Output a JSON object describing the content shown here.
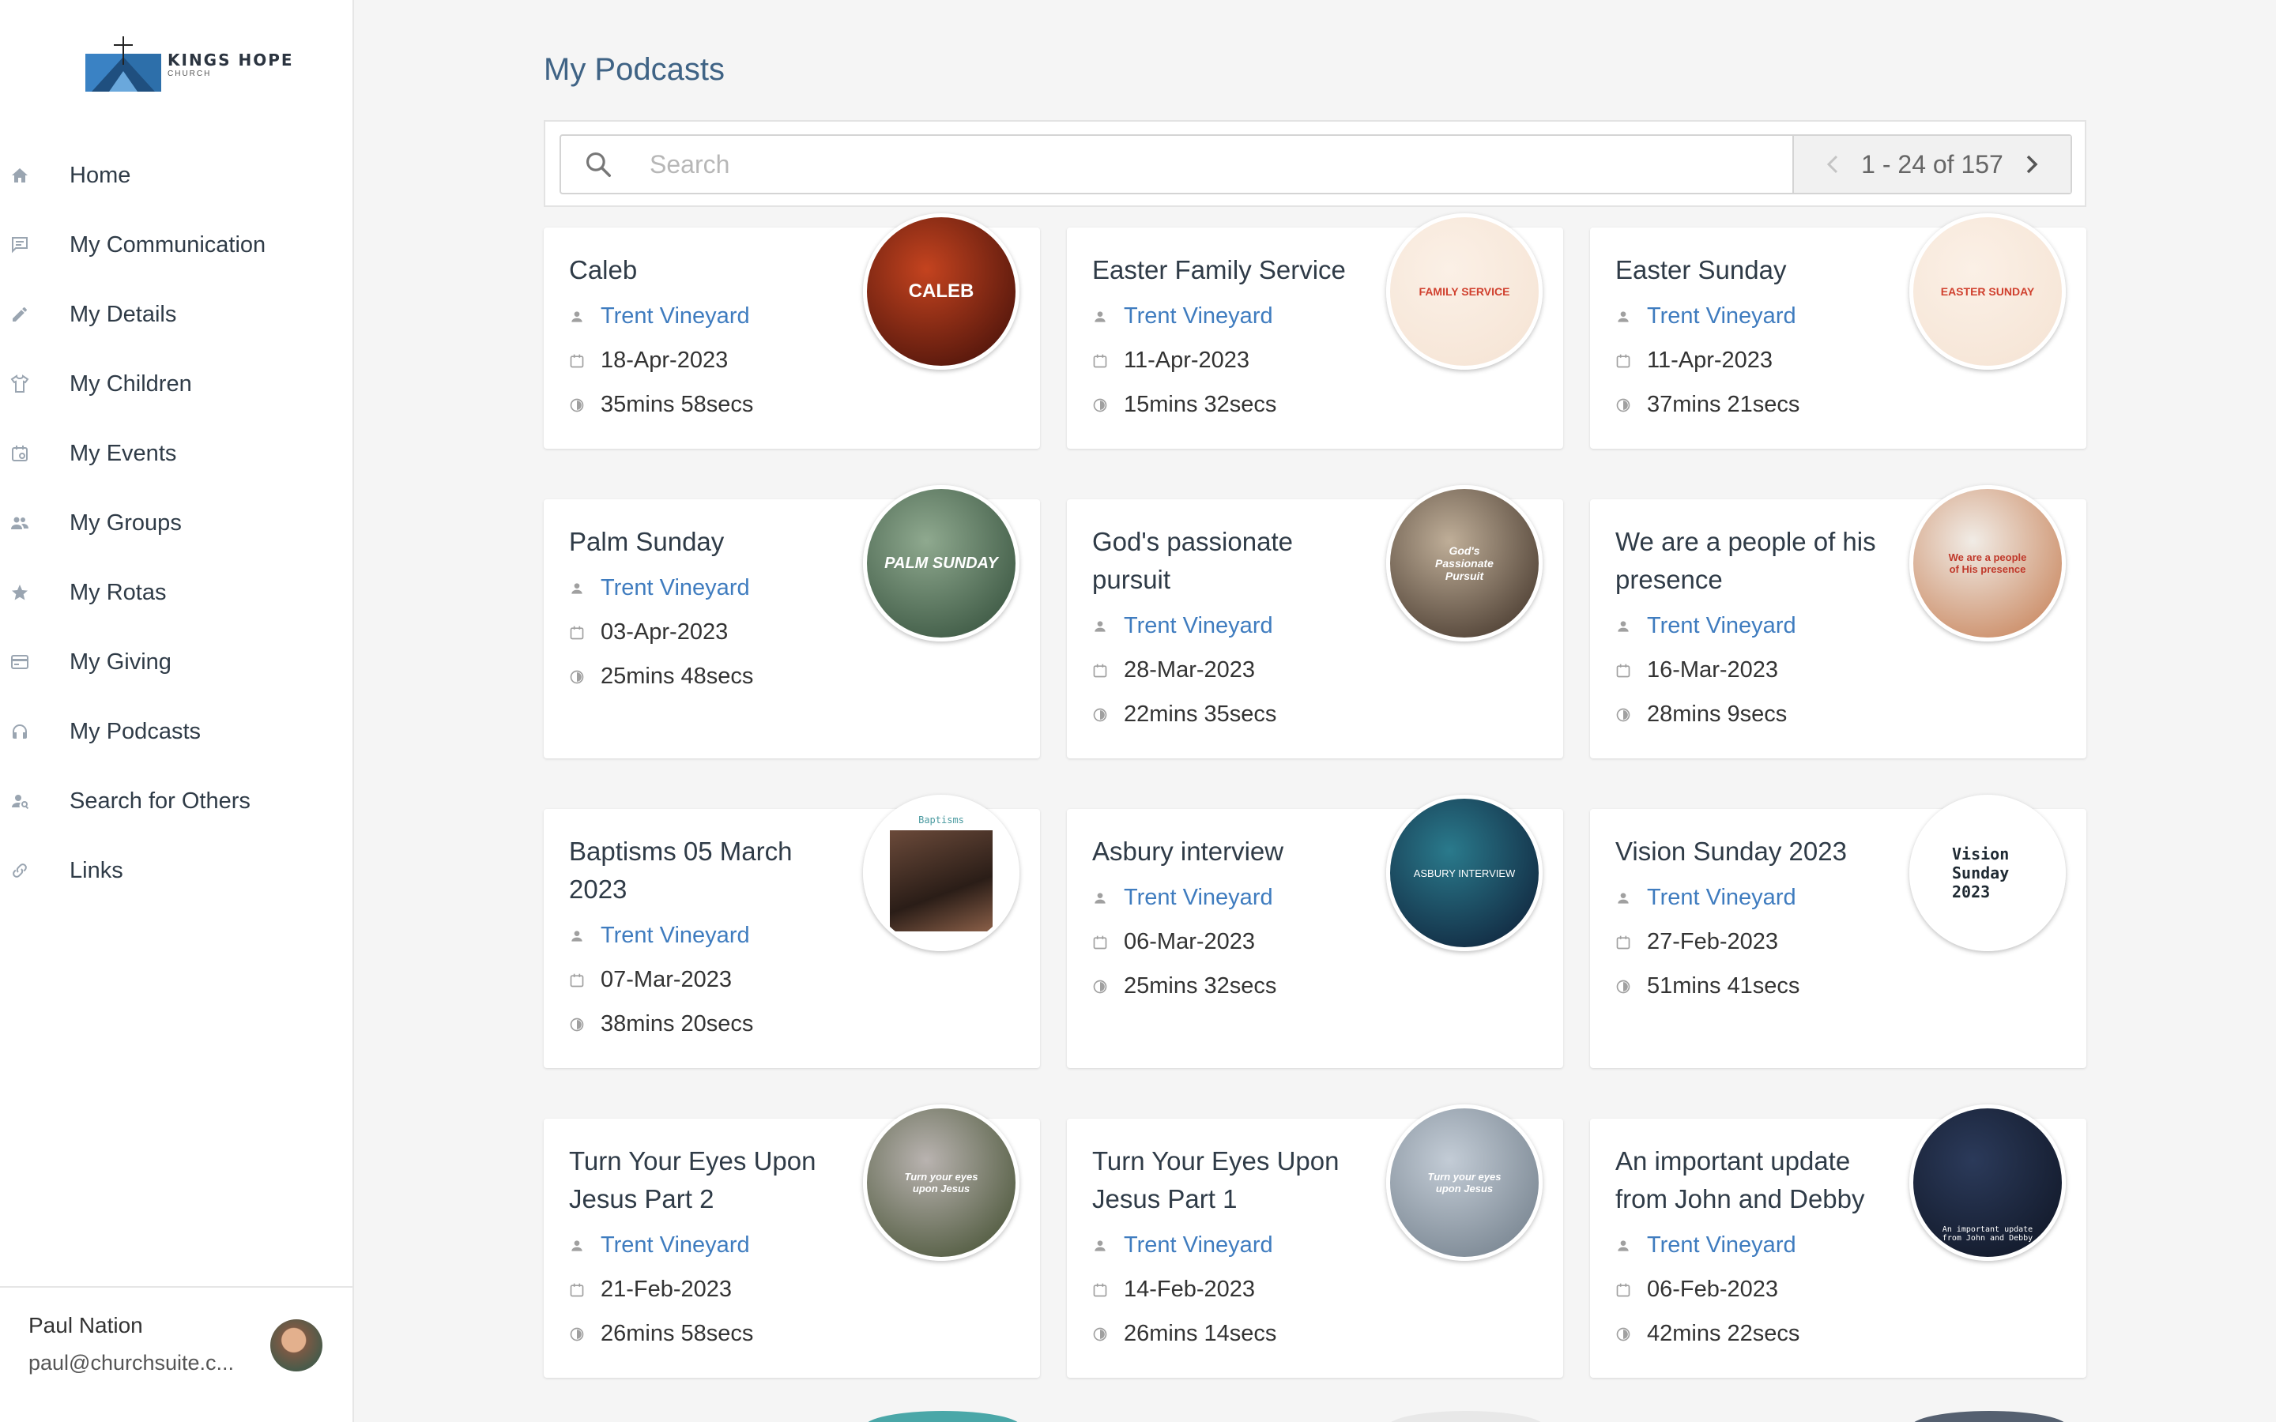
{
  "sidebar": {
    "logo": {
      "name": "KINGS HOPE",
      "sub": "CHURCH"
    },
    "items": [
      {
        "label": "Home",
        "icon": "home-icon"
      },
      {
        "label": "My Communication",
        "icon": "chat-icon"
      },
      {
        "label": "My Details",
        "icon": "pencil-icon"
      },
      {
        "label": "My Children",
        "icon": "shirt-icon"
      },
      {
        "label": "My Events",
        "icon": "calendar-icon"
      },
      {
        "label": "My Groups",
        "icon": "people-icon"
      },
      {
        "label": "My Rotas",
        "icon": "star-icon"
      },
      {
        "label": "My Giving",
        "icon": "credit-card-icon"
      },
      {
        "label": "My Podcasts",
        "icon": "headphones-icon"
      },
      {
        "label": "Search for Others",
        "icon": "person-search-icon"
      },
      {
        "label": "Links",
        "icon": "link-icon"
      }
    ],
    "user": {
      "name": "Paul Nation",
      "email": "paul@churchsuite.c..."
    }
  },
  "main": {
    "title": "My Podcasts",
    "search": {
      "placeholder": "Search",
      "value": ""
    },
    "pager": {
      "text": "1 - 24 of 157"
    }
  },
  "podcasts": [
    {
      "title": "Caleb",
      "author": "Trent Vineyard",
      "date": "18-Apr-2023",
      "duration": "35mins 58secs",
      "art": "CALEB",
      "colors": [
        "#c4431f",
        "#3b0d08"
      ],
      "textColor": "#ffffff"
    },
    {
      "title": "Easter Family Service",
      "author": "Trent Vineyard",
      "date": "11-Apr-2023",
      "duration": "15mins 32secs",
      "art": "FAMILY SERVICE",
      "colors": [
        "#fbf0e6",
        "#f5e3d3"
      ],
      "textColor": "#d0402e"
    },
    {
      "title": "Easter Sunday",
      "author": "Trent Vineyard",
      "date": "11-Apr-2023",
      "duration": "37mins 21secs",
      "art": "EASTER SUNDAY",
      "colors": [
        "#fbf0e6",
        "#f5e3d3"
      ],
      "textColor": "#d0402e"
    },
    {
      "title": "Palm Sunday",
      "author": "Trent Vineyard",
      "date": "03-Apr-2023",
      "duration": "25mins 48secs",
      "art": "PALM SUNDAY",
      "colors": [
        "#8fa98f",
        "#2e4a36"
      ],
      "textColor": "#ffffff"
    },
    {
      "title": "God's passionate pursuit",
      "author": "Trent Vineyard",
      "date": "28-Mar-2023",
      "duration": "22mins 35secs",
      "art": "God's Passionate Pursuit",
      "colors": [
        "#bfae98",
        "#3a2c22"
      ],
      "textColor": "#ffffff"
    },
    {
      "title": "We are a people of his presence",
      "author": "Trent Vineyard",
      "date": "16-Mar-2023",
      "duration": "28mins 9secs",
      "art": "We are a people of His presence",
      "colors": [
        "#f1ece6",
        "#c47a4e"
      ],
      "textColor": "#c0392b"
    },
    {
      "title": "Baptisms 05 March 2023",
      "author": "Trent Vineyard",
      "date": "07-Mar-2023",
      "duration": "38mins 20secs",
      "art": "Baptisms",
      "colors": [
        "#ffffff",
        "#ffffff"
      ],
      "textColor": "#4a9aa0"
    },
    {
      "title": "Asbury interview",
      "author": "Trent Vineyard",
      "date": "06-Mar-2023",
      "duration": "25mins 32secs",
      "art": "ASBURY INTERVIEW",
      "colors": [
        "#2a7a8c",
        "#0d1a33"
      ],
      "textColor": "#ffffff"
    },
    {
      "title": "Vision Sunday 2023",
      "author": "Trent Vineyard",
      "date": "27-Feb-2023",
      "duration": "51mins 41secs",
      "art": "Vision Sunday 2023",
      "colors": [
        "#ffffff",
        "#ffffff"
      ],
      "textColor": "#1f2a33"
    },
    {
      "title": "Turn Your Eyes Upon Jesus Part 2",
      "author": "Trent Vineyard",
      "date": "21-Feb-2023",
      "duration": "26mins 58secs",
      "art": "Turn your eyes upon Jesus",
      "colors": [
        "#b9b3b0",
        "#3d4a2a"
      ],
      "textColor": "#ffffff"
    },
    {
      "title": "Turn Your Eyes Upon Jesus Part 1",
      "author": "Trent Vineyard",
      "date": "14-Feb-2023",
      "duration": "26mins 14secs",
      "art": "Turn your eyes upon Jesus",
      "colors": [
        "#c3ccd6",
        "#6d7a86"
      ],
      "textColor": "#ffffff"
    },
    {
      "title": "An important update from John and Debby",
      "author": "Trent Vineyard",
      "date": "06-Feb-2023",
      "duration": "42mins 22secs",
      "art": "An important update from John and Debby",
      "colors": [
        "#2b3a5a",
        "#0e1422"
      ],
      "textColor": "#ffffff"
    }
  ]
}
